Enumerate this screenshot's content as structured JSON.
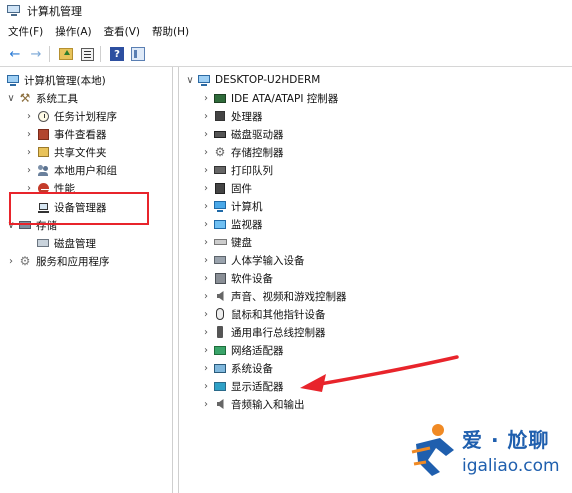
{
  "window": {
    "title": "计算机管理"
  },
  "menu": [
    "文件(F)",
    "操作(A)",
    "查看(V)",
    "帮助(H)"
  ],
  "toolbar": [
    "back-icon",
    "forward-icon",
    "up-one-level-icon",
    "properties-icon",
    "help-icon",
    "show-hide-pane-icon"
  ],
  "left_tree": [
    {
      "label": "计算机管理(本地)",
      "icon": "computer-icon"
    },
    {
      "label": "系统工具",
      "icon": "tools-icon"
    },
    {
      "label": "任务计划程序",
      "icon": "clock-icon"
    },
    {
      "label": "事件查看器",
      "icon": "event-viewer-icon"
    },
    {
      "label": "共享文件夹",
      "icon": "shared-folder-icon"
    },
    {
      "label": "本地用户和组",
      "icon": "users-icon"
    },
    {
      "label": "性能",
      "icon": "performance-icon"
    },
    {
      "label": "设备管理器",
      "icon": "device-manager-icon"
    },
    {
      "label": "存储",
      "icon": "storage-icon"
    },
    {
      "label": "磁盘管理",
      "icon": "disk-icon"
    },
    {
      "label": "服务和应用程序",
      "icon": "services-icon"
    }
  ],
  "device_tree": {
    "root": "DESKTOP-U2HDERM",
    "items": [
      {
        "label": "IDE ATA/ATAPI 控制器",
        "icon": "ide-controller-icon"
      },
      {
        "label": "处理器",
        "icon": "processor-icon"
      },
      {
        "label": "磁盘驱动器",
        "icon": "disk-drive-icon"
      },
      {
        "label": "存储控制器",
        "icon": "storage-controller-icon"
      },
      {
        "label": "打印队列",
        "icon": "print-queue-icon"
      },
      {
        "label": "固件",
        "icon": "firmware-icon"
      },
      {
        "label": "计算机",
        "icon": "computer-icon"
      },
      {
        "label": "监视器",
        "icon": "monitor-icon"
      },
      {
        "label": "键盘",
        "icon": "keyboard-icon"
      },
      {
        "label": "人体学输入设备",
        "icon": "hid-icon"
      },
      {
        "label": "软件设备",
        "icon": "software-device-icon"
      },
      {
        "label": "声音、视频和游戏控制器",
        "icon": "audio-icon"
      },
      {
        "label": "鼠标和其他指针设备",
        "icon": "mouse-icon"
      },
      {
        "label": "通用串行总线控制器",
        "icon": "usb-icon"
      },
      {
        "label": "网络适配器",
        "icon": "network-adapter-icon"
      },
      {
        "label": "系统设备",
        "icon": "system-device-icon"
      },
      {
        "label": "显示适配器",
        "icon": "display-adapter-icon"
      },
      {
        "label": "音频输入和输出",
        "icon": "audio-io-icon"
      }
    ]
  },
  "watermark": {
    "line1": "爱 · 尬聊",
    "line2": "igaliao.com"
  },
  "colors": {
    "highlight": "#e8242b",
    "watermark": "#1f5fae"
  }
}
